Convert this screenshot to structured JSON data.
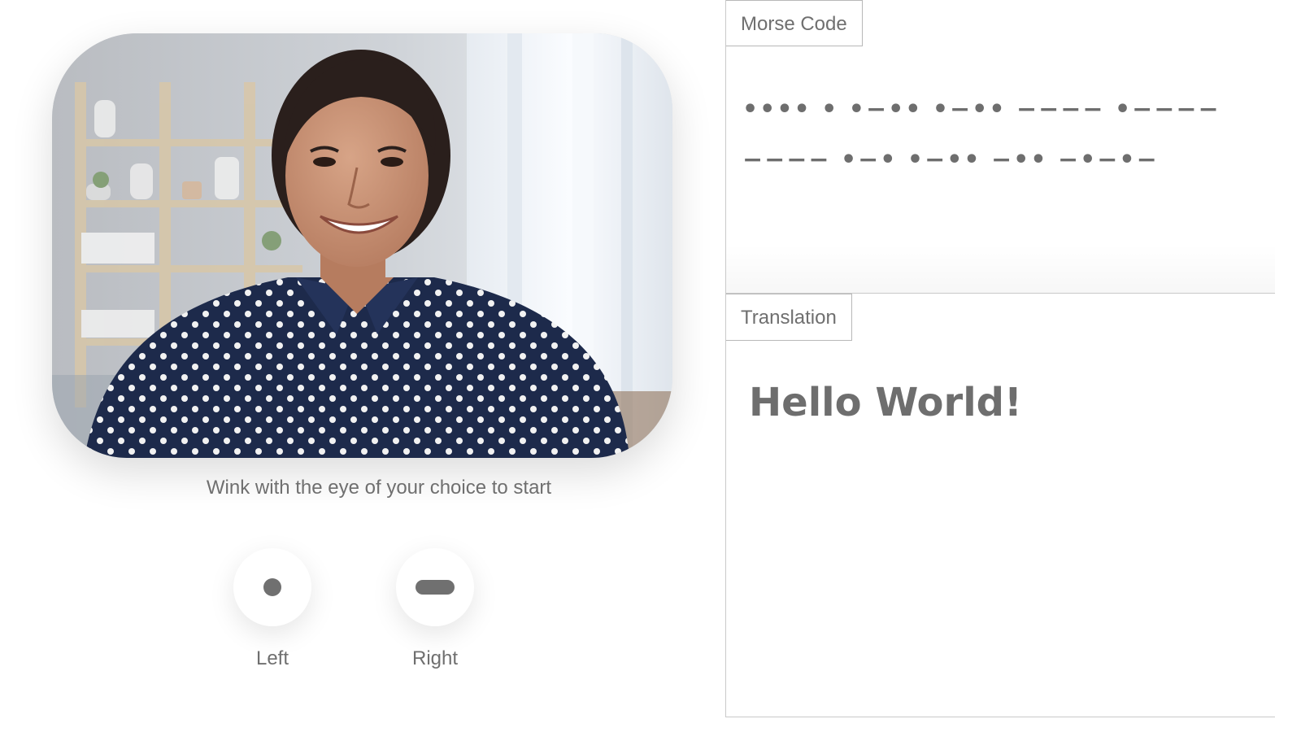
{
  "camera": {
    "content": "webcam-feed-smiling-woman"
  },
  "instruction": "Wink with the eye of your choice to start",
  "wink_buttons": [
    {
      "label": "Left",
      "symbol": "dot"
    },
    {
      "label": "Right",
      "symbol": "dash"
    }
  ],
  "morse_panel": {
    "tab_label": "Morse Code",
    "lines": [
      "•••• • •−•• •−•• −−−− •−−−−",
      "−−−− •−• •−•• −•• −•−•−"
    ]
  },
  "translation_panel": {
    "tab_label": "Translation",
    "text": "Hello World!"
  },
  "colors": {
    "text": "#6b6b6b",
    "border": "#c9c9c9",
    "symbol": "#707070"
  }
}
